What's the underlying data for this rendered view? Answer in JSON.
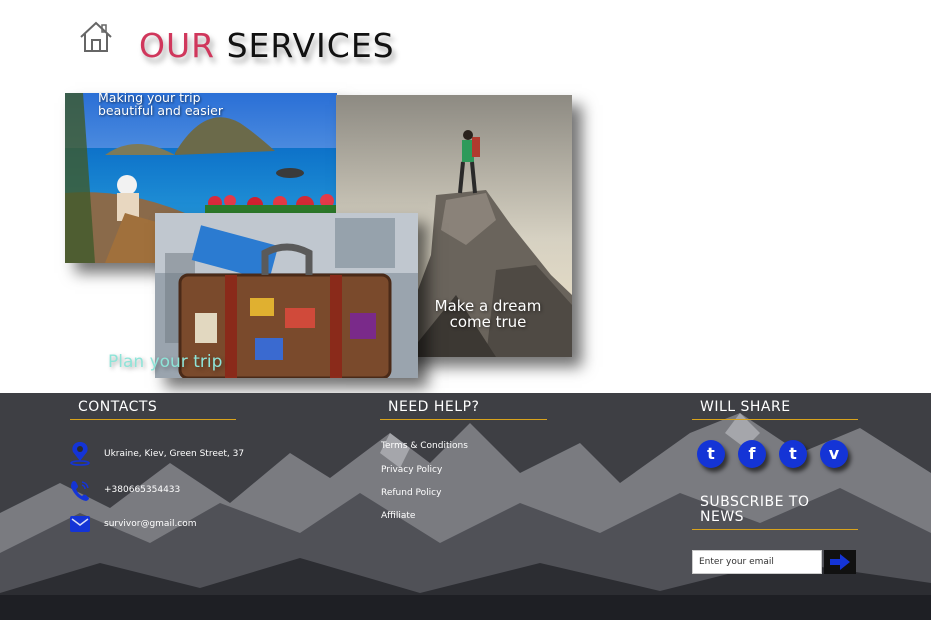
{
  "header": {
    "title_accent": "OUR",
    "title_rest": "SERVICES",
    "home_icon": "house-outline-icon"
  },
  "gallery": {
    "sea_caption": "Making your trip beautiful and easier",
    "dream_caption": "Make a dream come true",
    "plan_caption": "Plan your trip"
  },
  "contacts": {
    "heading": "CONTACTS",
    "address": "Ukraine, Kiev, Green Street, 37",
    "phone": "+380665354433",
    "email": "survivor@gmail.com",
    "icons": [
      "map-pin-icon",
      "phone-icon",
      "envelope-icon"
    ]
  },
  "help": {
    "heading": "NEED HELP?",
    "links": [
      "Terms & Conditions",
      "Privacy Policy",
      "Refund Policy",
      "Affiliate"
    ]
  },
  "share": {
    "heading": "WILL SHARE",
    "icons": [
      "twitter-icon",
      "facebook-icon",
      "tumblr-icon",
      "vimeo-icon"
    ],
    "glyphs": [
      "t",
      "f",
      "t",
      "v"
    ]
  },
  "subscribe": {
    "heading": "SUBSCRIBE TO NEWS",
    "placeholder": "Enter your email",
    "submit_icon": "arrow-right-icon"
  },
  "colors": {
    "accent": "#d0375c",
    "gold_rule": "#d9a31c",
    "social_blue": "#1434d6",
    "plan_caption": "#8ee4d8"
  }
}
